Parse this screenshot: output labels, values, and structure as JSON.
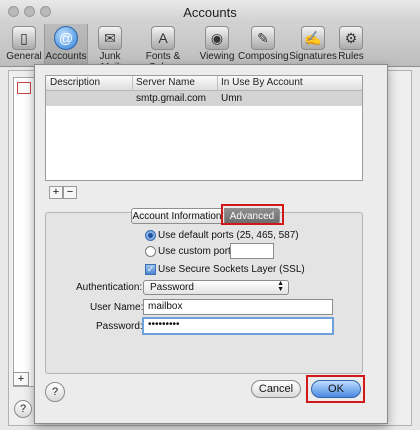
{
  "window": {
    "title": "Accounts"
  },
  "toolbar": {
    "items": [
      {
        "label": "General",
        "icon": "general-icon"
      },
      {
        "label": "Accounts",
        "icon": "accounts-icon"
      },
      {
        "label": "Junk Mail",
        "icon": "junk-mail-icon"
      },
      {
        "label": "Fonts & Colors",
        "icon": "fonts-colors-icon"
      },
      {
        "label": "Viewing",
        "icon": "viewing-icon"
      },
      {
        "label": "Composing",
        "icon": "composing-icon"
      },
      {
        "label": "Signatures",
        "icon": "signatures-icon"
      },
      {
        "label": "Rules",
        "icon": "rules-icon"
      }
    ],
    "selected": "Accounts"
  },
  "smtp_table": {
    "headers": [
      "Description",
      "Server Name",
      "In Use By Account"
    ],
    "rows": [
      {
        "description": "",
        "server": "smtp.gmail.com",
        "in_use": "Umn"
      }
    ]
  },
  "list_controls": {
    "add": "+",
    "remove": "−"
  },
  "tabs": {
    "account_info": "Account Information",
    "advanced": "Advanced",
    "selected": "Advanced"
  },
  "ports": {
    "default_label": "Use default ports (25, 465, 587)",
    "custom_label": "Use custom port:",
    "custom_value": "",
    "selected": "default"
  },
  "ssl": {
    "label": "Use Secure Sockets Layer (SSL)",
    "checked": true
  },
  "auth": {
    "label": "Authentication:",
    "value": "Password"
  },
  "username": {
    "label": "User Name:",
    "value": "mailbox"
  },
  "password": {
    "label": "Password:",
    "value": "•••••••••"
  },
  "buttons": {
    "help": "?",
    "cancel": "Cancel",
    "ok": "OK"
  },
  "background": {
    "add": "+",
    "help": "?"
  },
  "colors": {
    "highlight": "#d01818",
    "default_button": "#4a8be0",
    "selected_row": "#d4d4d4"
  }
}
